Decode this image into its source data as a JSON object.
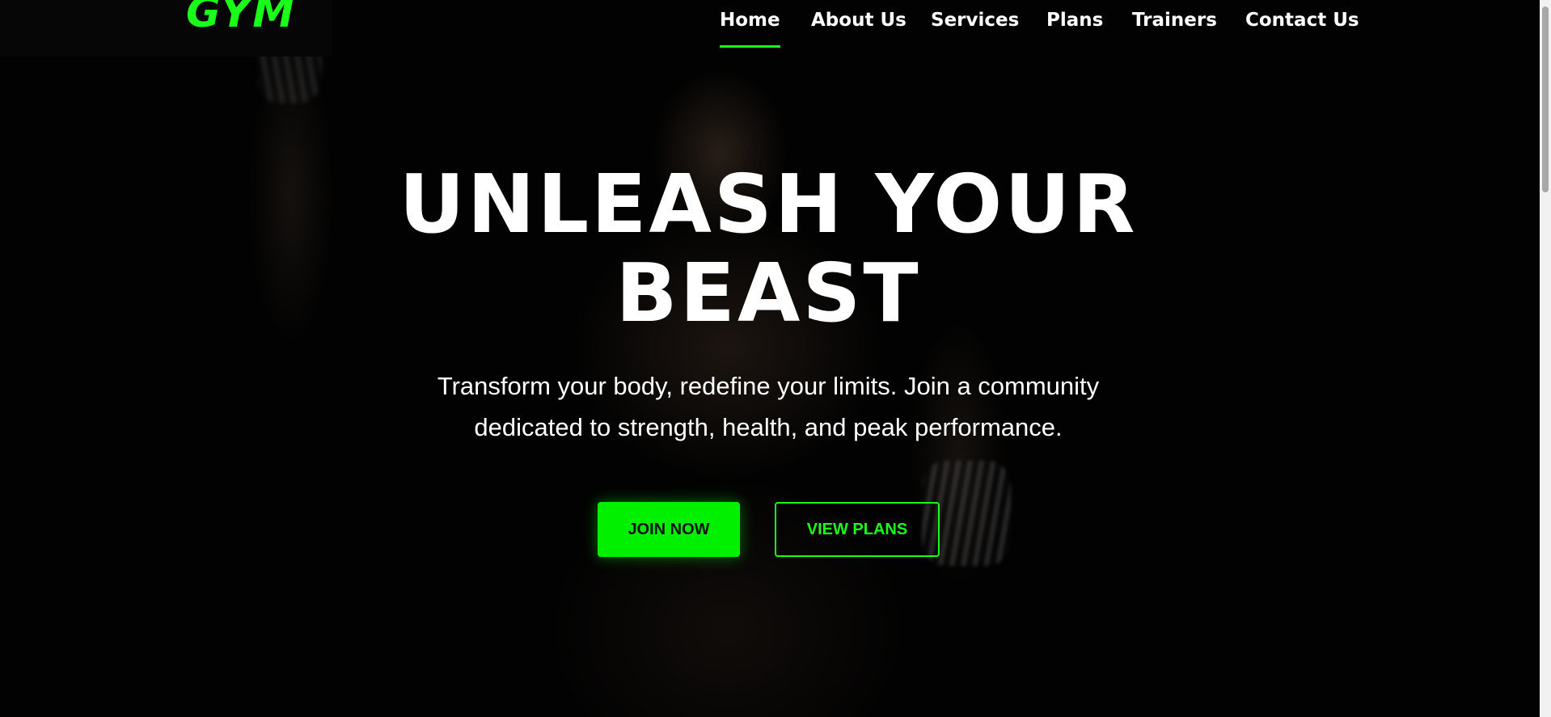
{
  "brand": {
    "logo_text": "GYM",
    "accent_color": "#1aff1a"
  },
  "nav": {
    "items": [
      {
        "label": "Home",
        "active": true
      },
      {
        "label": "About Us"
      },
      {
        "label": "Services"
      },
      {
        "label": "Plans"
      },
      {
        "label": "Trainers"
      },
      {
        "label": "Contact Us"
      }
    ]
  },
  "hero": {
    "title_line1": "UNLEASH YOUR",
    "title_line2": "BEAST",
    "subtitle_line1": "Transform your body, redefine your limits. Join a community",
    "subtitle_line2": "dedicated to strength, health, and peak performance.",
    "primary_button": "JOIN NOW",
    "secondary_button": "VIEW PLANS"
  }
}
